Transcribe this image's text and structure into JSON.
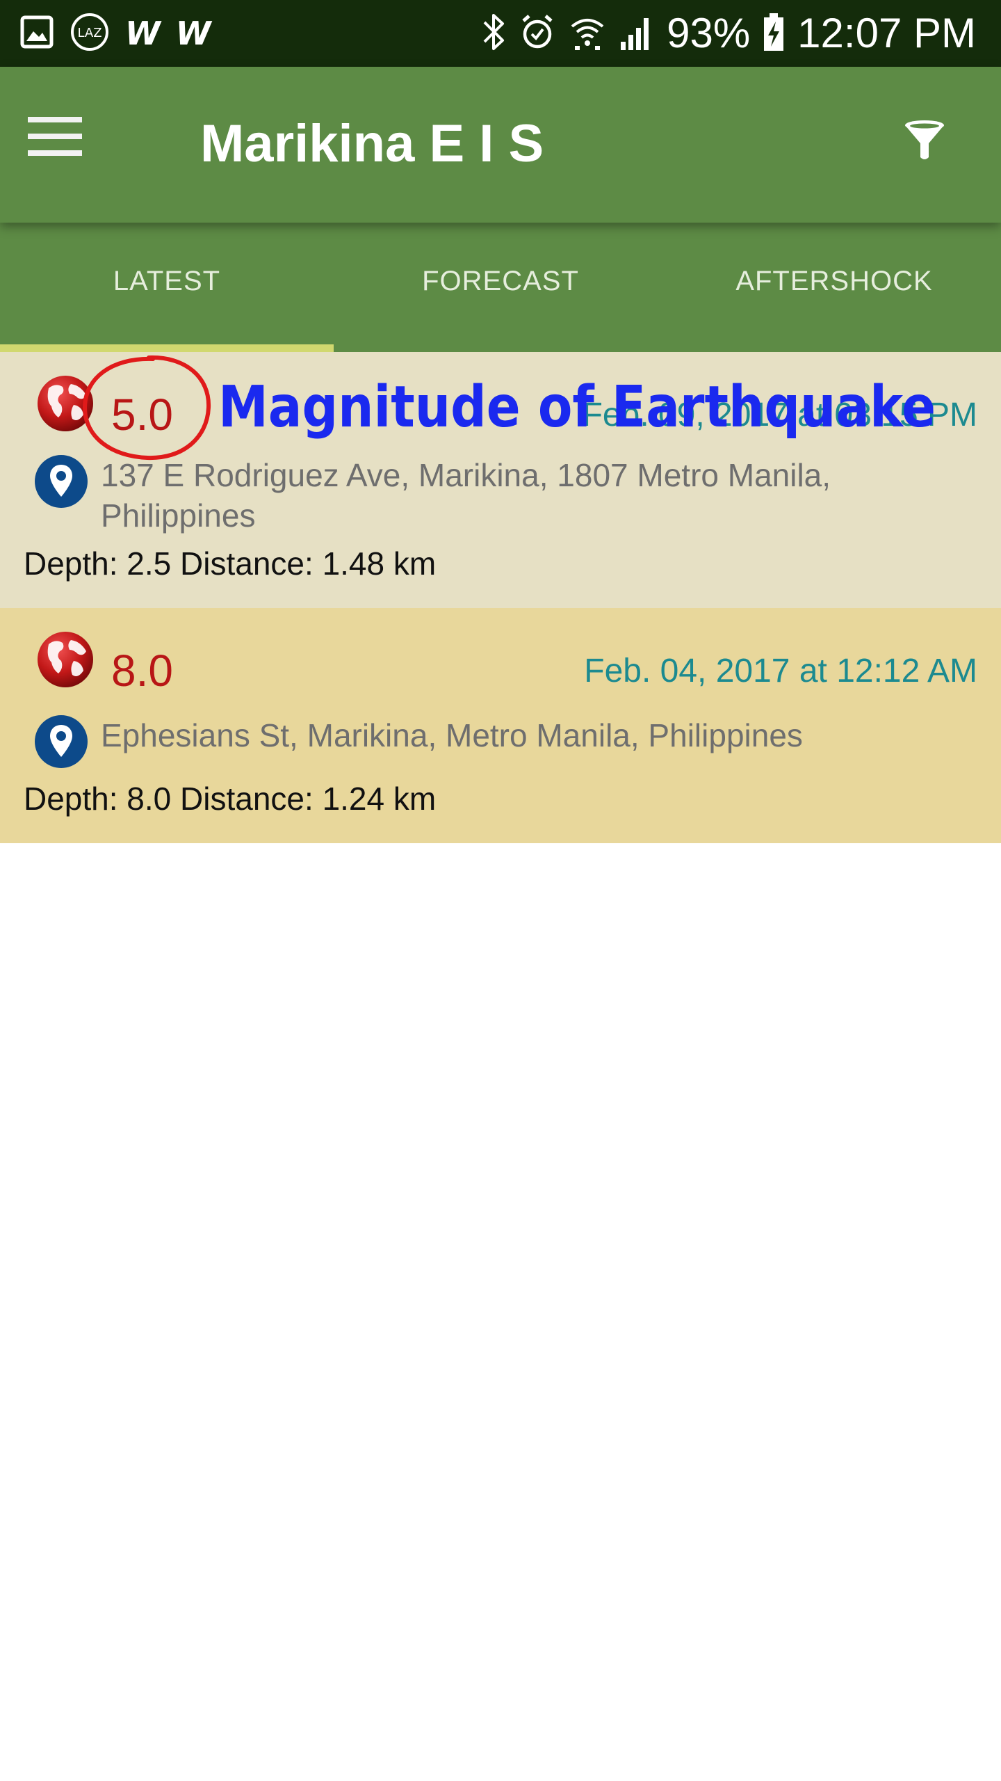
{
  "status_bar": {
    "left_icons": [
      "gallery-icon",
      "laz-icon",
      "w-icon",
      "w-icon"
    ],
    "w_glyph": "W",
    "laz_label": "LAZ",
    "battery": "93%",
    "time": "12:07 PM",
    "right_icons": [
      "bluetooth-icon",
      "alarm-icon",
      "wifi-icon",
      "signal-icon",
      "battery-charging-icon"
    ]
  },
  "app_bar": {
    "title": "Marikina E I S",
    "menu_icon": "hamburger-menu-icon",
    "filter_icon": "filter-icon",
    "color": "#5d8b45"
  },
  "tabs": [
    {
      "label": "LATEST",
      "active": true
    },
    {
      "label": "FORECAST",
      "active": false
    },
    {
      "label": "AFTERSHOCK",
      "active": false
    }
  ],
  "quakes": [
    {
      "magnitude": "5.0",
      "datetime": "Feb. 09, 2017 at 03:15 PM",
      "address": "137 E Rodriguez Ave, Marikina, 1807 Metro Manila, Philippines",
      "depth_distance": "Depth: 2.5 Distance: 1.48 km",
      "background": "#e6e0c4"
    },
    {
      "magnitude": "8.0",
      "datetime": "Feb. 04, 2017 at 12:12 AM",
      "address": "Ephesians St, Marikina, Metro Manila, Philippines",
      "depth_distance": "Depth: 8.0 Distance: 1.24 km",
      "background": "#e8d79b"
    }
  ],
  "annotation": {
    "text": "Magnitude of Earthquake",
    "color": "#1a29ef",
    "circle_color": "#e01a1a"
  },
  "colors": {
    "magnitude": "#b81616",
    "datetime": "#1c8a90",
    "address": "#6e6e6e",
    "tab_indicator": "#d1d86f"
  }
}
